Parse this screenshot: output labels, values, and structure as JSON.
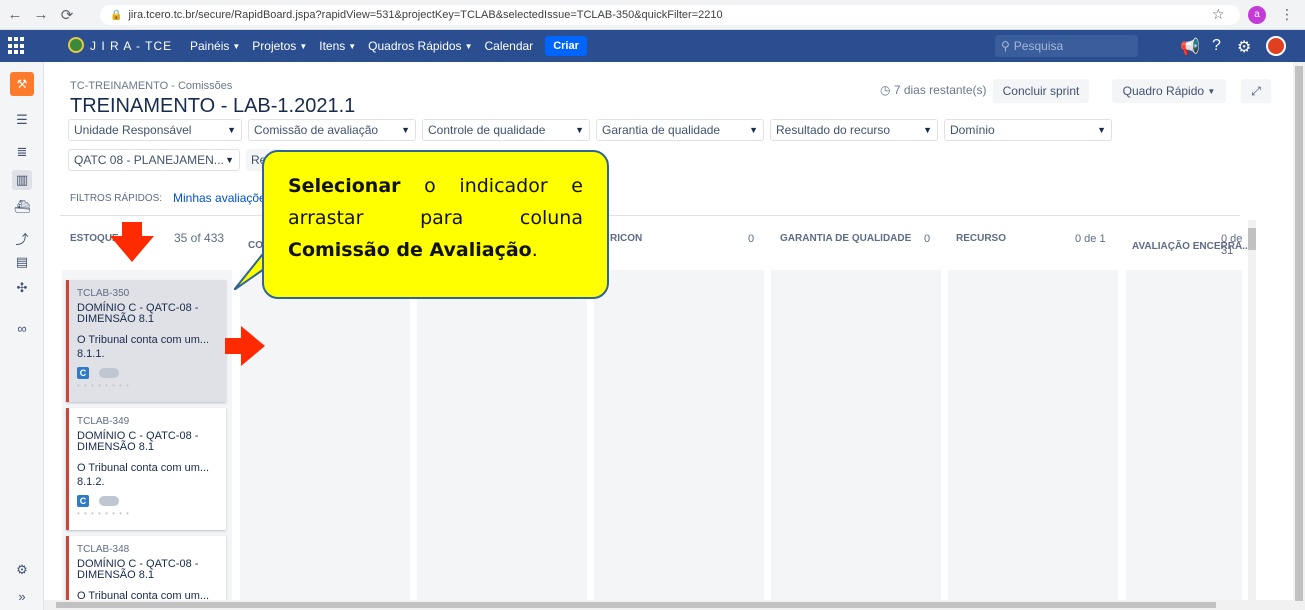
{
  "browser": {
    "url": "jira.tcero.tc.br/secure/RapidBoard.jspa?rapidView=531&projectKey=TCLAB&selectedIssue=TCLAB-350&quickFilter=2210",
    "profile_letter": "a"
  },
  "header": {
    "logo_text": "J I R A - TCE",
    "nav": [
      "Painéis",
      "Projetos",
      "Itens",
      "Quadros Rápidos"
    ],
    "calendar": "Calendar",
    "create": "Criar",
    "search_placeholder": "Pesquisa"
  },
  "board": {
    "breadcrumb": "TC-TREINAMENTO - Comissões",
    "title": "TREINAMENTO - LAB-1.2021.1",
    "days_remaining": "7 dias restante(s)",
    "complete_sprint": "Concluir sprint",
    "quick_board": "Quadro Rápido",
    "filters": [
      "Unidade Responsável",
      "Comissão de avaliação",
      "Controle de qualidade",
      "Garantia de qualidade",
      "Resultado do recurso",
      "Domínio"
    ],
    "filter_row2": "QATC 08 - PLANEJAMEN...",
    "filter_row2_btn": "Re",
    "quick_filters_label": "FILTROS RÁPIDOS:",
    "quick_filter_link": "Minhas avaliaçõe"
  },
  "columns": [
    {
      "name": "ESTOQUE",
      "count": "35 of 433"
    },
    {
      "name": "CO",
      "count": ""
    },
    {
      "name": "",
      "count": ""
    },
    {
      "name": "RICON",
      "count": "0"
    },
    {
      "name": "GARANTIA DE QUALIDADE",
      "count": "0"
    },
    {
      "name": "RECURSO",
      "count": "0 de 1"
    },
    {
      "name": "AVALIAÇÃO ENCERRA...",
      "count": "0 de 31"
    }
  ],
  "cards": [
    {
      "key": "TCLAB-350",
      "summary": "DOMÍNIO C - QATC-08 - DIMENSÃO 8.1",
      "desc": "O Tribunal conta com um... 8.1.1.",
      "type": "C"
    },
    {
      "key": "TCLAB-349",
      "summary": "DOMÍNIO C - QATC-08 - DIMENSÃO 8.1",
      "desc": "O Tribunal conta com um... 8.1.2.",
      "type": "C"
    },
    {
      "key": "TCLAB-348",
      "summary": "DOMÍNIO C - QATC-08 - DIMENSÃO 8.1",
      "desc": "O Tribunal conta com um...",
      "type": "C"
    }
  ],
  "callout": {
    "word1": "Selecionar",
    "text1": " o indicador e arrastar para coluna ",
    "word2": "Comissão de Avaliação",
    "text2": "."
  },
  "colors": {
    "accent": "#2a4e8f",
    "card_border": "#d04437",
    "callout_bg": "#ffff00",
    "arrow": "#ff2a00"
  }
}
